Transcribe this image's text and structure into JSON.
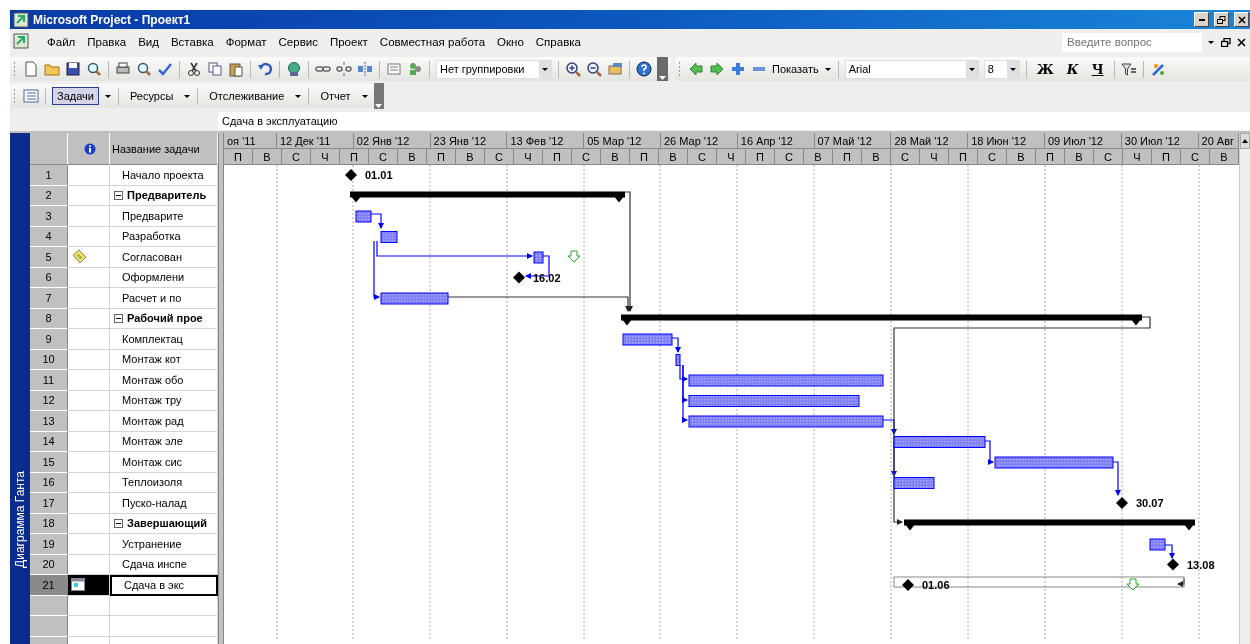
{
  "window": {
    "title": "Microsoft Project - Проект1"
  },
  "menu": [
    {
      "label": "Файл"
    },
    {
      "label": "Правка"
    },
    {
      "label": "Вид"
    },
    {
      "label": "Вставка"
    },
    {
      "label": "Формат"
    },
    {
      "label": "Сервис"
    },
    {
      "label": "Проект"
    },
    {
      "label": "Совместная работа"
    },
    {
      "label": "Окно"
    },
    {
      "label": "Справка"
    }
  ],
  "help_box": {
    "placeholder": "Введите вопрос"
  },
  "standard_toolbar": {
    "grouping": "Нет группировки"
  },
  "formatting_toolbar": {
    "show_menu": "Показать",
    "font": "Arial",
    "size": "8",
    "bold": "Ж",
    "italic": "К",
    "underline": "Ч"
  },
  "guide_toolbar": [
    {
      "label": "Задачи",
      "selected": true
    },
    {
      "label": "Ресурсы",
      "selected": false
    },
    {
      "label": "Отслеживание",
      "selected": false
    },
    {
      "label": "Отчет",
      "selected": false
    }
  ],
  "entry_bar": {
    "value": "Сдача в эксплуатацию"
  },
  "view_bar": {
    "label": "Диаграмма Ганта"
  },
  "table": {
    "name_header": "Название задачи",
    "rows": [
      {
        "id": "1",
        "name": "Начало проекта",
        "summary": false,
        "selected": false,
        "milestone_label": "01.01"
      },
      {
        "id": "2",
        "name": "Предваритель",
        "summary": true,
        "selected": false
      },
      {
        "id": "3",
        "name": "Предварите",
        "summary": false,
        "selected": false
      },
      {
        "id": "4",
        "name": "Разработка",
        "summary": false,
        "selected": false
      },
      {
        "id": "5",
        "name": "Согласован",
        "summary": false,
        "selected": false,
        "indicator": {
          "kind": "note"
        }
      },
      {
        "id": "6",
        "name": "Оформлени",
        "summary": false,
        "selected": false,
        "milestone_label": "16.02"
      },
      {
        "id": "7",
        "name": "Расчет и по",
        "summary": false,
        "selected": false
      },
      {
        "id": "8",
        "name": "Рабочий прое",
        "summary": true,
        "selected": false
      },
      {
        "id": "9",
        "name": "Комплектац",
        "summary": false,
        "selected": false
      },
      {
        "id": "10",
        "name": "Монтаж кот",
        "summary": false,
        "selected": false
      },
      {
        "id": "11",
        "name": "Монтаж обо",
        "summary": false,
        "selected": false
      },
      {
        "id": "12",
        "name": "Монтаж тру",
        "summary": false,
        "selected": false
      },
      {
        "id": "13",
        "name": "Монтаж рад",
        "summary": false,
        "selected": false
      },
      {
        "id": "14",
        "name": "Монтаж эле",
        "summary": false,
        "selected": false
      },
      {
        "id": "15",
        "name": "Монтаж сис",
        "summary": false,
        "selected": false
      },
      {
        "id": "16",
        "name": "Теплоизоля",
        "summary": false,
        "selected": false
      },
      {
        "id": "17",
        "name": "Пуско-налад",
        "summary": false,
        "selected": false,
        "milestone_label": "30.07"
      },
      {
        "id": "18",
        "name": "Завершающий",
        "summary": true,
        "selected": false
      },
      {
        "id": "19",
        "name": "Устранение",
        "summary": false,
        "selected": false
      },
      {
        "id": "20",
        "name": "Сдача инспе",
        "summary": false,
        "selected": false,
        "milestone_label": "13.08"
      },
      {
        "id": "21",
        "name": "Сдача в экс",
        "summary": false,
        "selected": true,
        "indicator": {
          "kind": "calendar"
        },
        "milestone_label": "01.06"
      }
    ]
  },
  "timescale": {
    "major": [
      "оя '11",
      "12 Дек '11",
      "02 Янв '12",
      "23 Янв '12",
      "13 Фев '12",
      "05 Мар '12",
      "26 Мар '12",
      "16 Апр '12",
      "07 Май '12",
      "28 Май '12",
      "18 Июн '12",
      "09 Июл '12",
      "30 Июл '12",
      "20 Авг"
    ],
    "minor": [
      "П",
      "В",
      "С",
      "Ч",
      "П",
      "С",
      "В",
      "П",
      "В",
      "С",
      "Ч",
      "П",
      "С",
      "В",
      "П",
      "В",
      "С",
      "Ч",
      "П",
      "С",
      "В",
      "П",
      "В",
      "С",
      "Ч",
      "П",
      "С",
      "В",
      "П",
      "В",
      "С",
      "Ч",
      "П",
      "С",
      "В"
    ]
  }
}
